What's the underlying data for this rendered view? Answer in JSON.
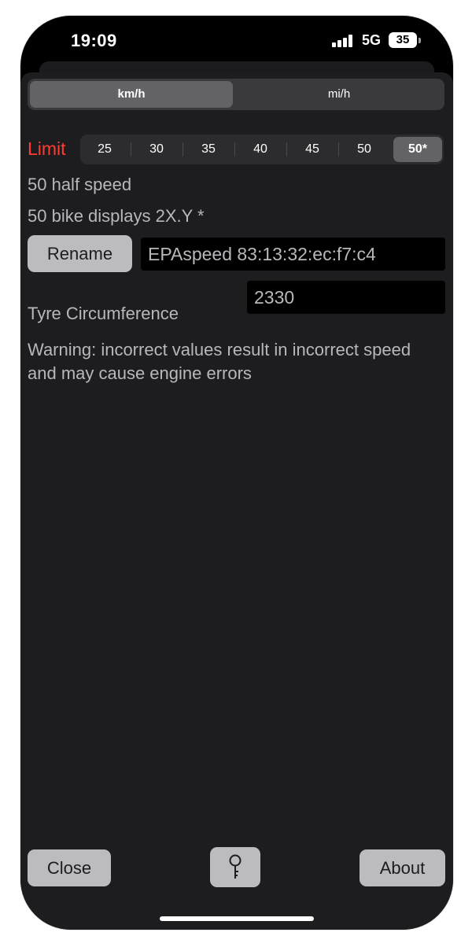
{
  "status_bar": {
    "time": "19:09",
    "network": "5G",
    "battery": "35"
  },
  "units": {
    "options": [
      "km/h",
      "mi/h"
    ],
    "selected": "km/h"
  },
  "limit": {
    "label": "Limit",
    "options": [
      "25",
      "30",
      "35",
      "40",
      "45",
      "50",
      "50*"
    ],
    "selected": "50*"
  },
  "info_lines": [
    "50 half speed",
    "50 bike displays 2X.Y *"
  ],
  "rename": {
    "button_label": "Rename",
    "device_name": "EPAspeed 83:13:32:ec:f7:c4"
  },
  "tyre": {
    "label": "Tyre Circumference",
    "value": "2330"
  },
  "warning": "Warning: incorrect values result in incorrect speed and may cause engine errors",
  "footer": {
    "close_label": "Close",
    "key_icon": "key-icon",
    "about_label": "About"
  },
  "colors": {
    "limit_label": "#ff3b30",
    "sheet_background": "#1d1d1f",
    "button_background": "#bcbcc0"
  }
}
